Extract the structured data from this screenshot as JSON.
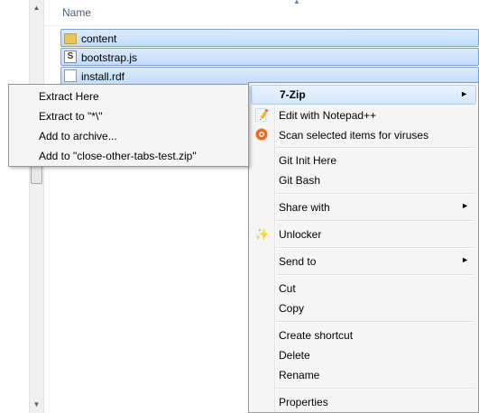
{
  "header": {
    "name_column": "Name"
  },
  "files": [
    {
      "name": "content",
      "icon": "folder-icon"
    },
    {
      "name": "bootstrap.js",
      "icon": "js-file-icon"
    },
    {
      "name": "install.rdf",
      "icon": "file-icon"
    }
  ],
  "context_menu": {
    "items": [
      {
        "label": "7-Zip",
        "submenu": true,
        "highlighted": true
      },
      {
        "label": "Edit with Notepad++",
        "icon": "notepad-icon"
      },
      {
        "label": "Scan selected items for viruses",
        "icon": "antivirus-icon"
      },
      {
        "label": "Git Init Here"
      },
      {
        "label": "Git Bash"
      },
      {
        "label": "Share with",
        "submenu": true
      },
      {
        "label": "Unlocker",
        "icon": "unlocker-icon"
      },
      {
        "label": "Send to",
        "submenu": true
      },
      {
        "label": "Cut"
      },
      {
        "label": "Copy"
      },
      {
        "label": "Create shortcut"
      },
      {
        "label": "Delete"
      },
      {
        "label": "Rename"
      },
      {
        "label": "Properties"
      }
    ]
  },
  "submenu_7zip": {
    "items": [
      {
        "label": "Extract Here"
      },
      {
        "label": "Extract to \"*\\\""
      },
      {
        "label": "Add to archive..."
      },
      {
        "label": "Add to \"close-other-tabs-test.zip\""
      }
    ]
  },
  "colors": {
    "selection": "#cce4fc",
    "menu_bg": "#f5f5f5",
    "header_text": "#4c607a"
  }
}
